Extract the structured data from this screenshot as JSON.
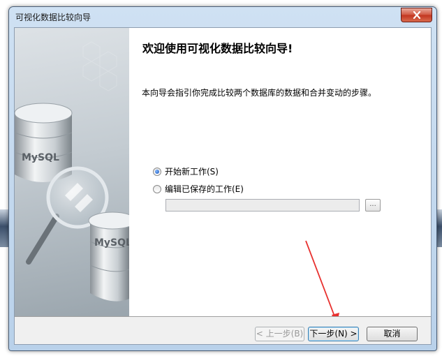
{
  "window": {
    "title": "可视化数据比较向导"
  },
  "side_image": {
    "logo_text_1": "MySQL",
    "logo_text_2": "MySQL"
  },
  "main": {
    "heading": "欢迎使用可视化数据比较向导!",
    "description": "本向导会指引你完成比较两个数据库的数据和合并变动的步骤。",
    "options": [
      {
        "label": "开始新工作(S)",
        "selected": true
      },
      {
        "label": "编辑已保存的工作(E)",
        "selected": false
      }
    ],
    "saved_job_path": {
      "value": "",
      "placeholder": ""
    },
    "browse_label": "..."
  },
  "buttons": {
    "back": "< 上一步(B)",
    "next": "下一步(N) >",
    "cancel": "取消"
  },
  "colors": {
    "arrow": "#e8312f",
    "title_bar": "#c6dbf0",
    "close_button": "#c7402b"
  }
}
